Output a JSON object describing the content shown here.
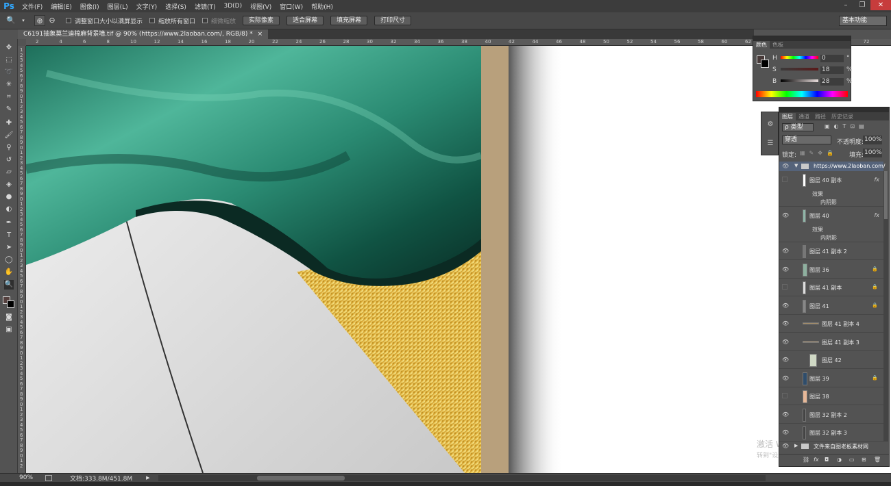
{
  "app": {
    "logo": "Ps"
  },
  "menu": [
    "文件(F)",
    "编辑(E)",
    "图像(I)",
    "图层(L)",
    "文字(Y)",
    "选择(S)",
    "滤镜(T)",
    "3D(D)",
    "视图(V)",
    "窗口(W)",
    "帮助(H)"
  ],
  "window_controls": {
    "minimize": "–",
    "restore": "❐",
    "close": "✕"
  },
  "options": {
    "resize_windows": "调整窗口大小以满屏显示",
    "zoom_all": "缩放所有窗口",
    "scrubby_zoom": "细微缩放",
    "actual_pixels": "实际像素",
    "fit_screen": "适合屏幕",
    "fill_screen": "填充屏幕",
    "print_size": "打印尺寸",
    "workspace": "基本功能"
  },
  "document": {
    "tab_title": "C6191抽象莫兰迪棉麻背景墙.tif @ 90% (https://www.2laoban.com/, RGB/8) *",
    "close": "×"
  },
  "ruler": {
    "top_ticks": [
      "2",
      "4",
      "6",
      "8",
      "10",
      "12",
      "14",
      "16",
      "18",
      "20",
      "22",
      "24",
      "26",
      "28",
      "30",
      "32",
      "34",
      "36",
      "38",
      "40",
      "42",
      "44",
      "46",
      "48",
      "50",
      "52",
      "54",
      "56",
      "58",
      "60",
      "62",
      "64",
      "66",
      "68",
      "70",
      "72"
    ],
    "left_ticks": [
      "1",
      "2",
      "3",
      "4",
      "5",
      "6",
      "7",
      "8",
      "9",
      "0",
      "1",
      "2",
      "3",
      "4",
      "5",
      "6",
      "7",
      "8",
      "9",
      "0",
      "1",
      "2",
      "3",
      "4",
      "5",
      "6",
      "7",
      "8",
      "9",
      "0",
      "1",
      "2",
      "3",
      "4",
      "5",
      "6",
      "7",
      "8",
      "9",
      "0",
      "1",
      "2",
      "3",
      "4",
      "5",
      "6",
      "7",
      "8",
      "9",
      "0",
      "1",
      "2",
      "3",
      "4",
      "5",
      "6",
      "7",
      "8",
      "9",
      "0",
      "1",
      "2",
      "3",
      "4",
      "5",
      "6",
      "7",
      "8",
      "9",
      "0",
      "1",
      "2",
      "3",
      "4",
      "5",
      "6",
      "7",
      "8",
      "9",
      "0",
      "1",
      "2"
    ]
  },
  "status": {
    "zoom": "90%",
    "doc_info": "文档:333.8M/451.8M",
    "arrow": "▶"
  },
  "color_panel": {
    "tabs": [
      "颜色",
      "色板"
    ],
    "h_label": "H",
    "h_value": "0",
    "h_unit": "°",
    "s_label": "S",
    "s_value": "18",
    "s_unit": "%",
    "b_label": "B",
    "b_value": "28",
    "b_unit": "%"
  },
  "layers_panel": {
    "tabs": [
      "图层",
      "通道",
      "路径",
      "历史记录"
    ],
    "filter_kind": "ρ 类型",
    "blend_mode": "穿透",
    "opacity_label": "不透明度:",
    "opacity_value": "100%",
    "lock_label": "锁定:",
    "fill_label": "填充:",
    "fill_value": "100%",
    "group_name": "https://www.2laoban.com/",
    "effects_label": "效果",
    "inner_shadow_label": "内阴影",
    "fx_label": "fx",
    "bottom_group_name": "文件来自图老板素材网",
    "layers": [
      {
        "name": "图层 40 副本",
        "visible": false,
        "locked": false,
        "fx": true
      },
      {
        "name": "图层 40",
        "visible": true,
        "locked": false,
        "fx": true
      },
      {
        "name": "图层 41 副本 2",
        "visible": true,
        "locked": false,
        "fx": false
      },
      {
        "name": "图层 36",
        "visible": true,
        "locked": true,
        "fx": false
      },
      {
        "name": "图层 41 副本",
        "visible": false,
        "locked": true,
        "fx": false
      },
      {
        "name": "图层 41",
        "visible": true,
        "locked": true,
        "fx": false
      },
      {
        "name": "图层 41 副本 4",
        "visible": true,
        "locked": false,
        "fx": false
      },
      {
        "name": "图层 41 副本 3",
        "visible": true,
        "locked": false,
        "fx": false
      },
      {
        "name": "图层 42",
        "visible": true,
        "locked": false,
        "fx": false
      },
      {
        "name": "图层 39",
        "visible": true,
        "locked": true,
        "fx": false
      },
      {
        "name": "图层 38",
        "visible": false,
        "locked": false,
        "fx": false
      },
      {
        "name": "图层 32 副本 2",
        "visible": true,
        "locked": false,
        "fx": false
      },
      {
        "name": "图层 32 副本 3",
        "visible": true,
        "locked": false,
        "fx": false
      }
    ]
  },
  "watermark": {
    "line1": "激活 Windows",
    "line2": "转到\"设置\"以激活 Windows。"
  },
  "colors": {
    "teal": "#2f8f78",
    "gold": "#d9aa2c",
    "tan": "#b8a07c",
    "panel_bg": "#535353"
  }
}
